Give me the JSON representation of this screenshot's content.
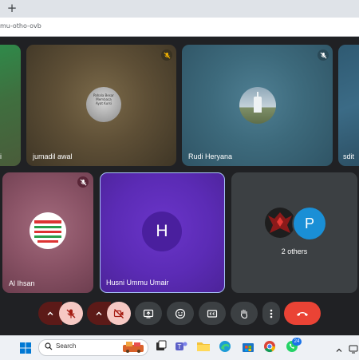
{
  "browser": {
    "new_tab_symbol": "+",
    "url_fragment": "mu-otho-ovb"
  },
  "participants": {
    "left_partial_name": "i",
    "jumadil_name": "jumadil awal",
    "jumadil_poster_lines": [
      "Pahala Besar",
      "Membaca",
      "Ayat Kursi"
    ],
    "rudi_name": "Rudi Heryana",
    "right_partial_name": "sdit",
    "al_ihsan_name": "Al Ihsan",
    "husni_name": "Husni Ummu Umair",
    "husni_initial": "H",
    "others_initial": "P",
    "others_label": "2 others"
  },
  "controls": {
    "items": [
      "mic-options",
      "mic-off",
      "camera-options",
      "camera-off",
      "present",
      "reactions",
      "captions",
      "raise-hand",
      "more",
      "end-call"
    ]
  },
  "taskbar": {
    "search_placeholder": "Search",
    "whatsapp_badge": "24"
  },
  "colors": {
    "meet_background": "#202124",
    "control_gray": "#3c4043",
    "control_red": "#ea4335",
    "control_dark_red": "#5c1a18",
    "husni_tile": "#5b2bb5",
    "husni_border": "#a6c1f5",
    "others_tile": "#3c4043",
    "avatar_blue": "#1a8fd6"
  }
}
